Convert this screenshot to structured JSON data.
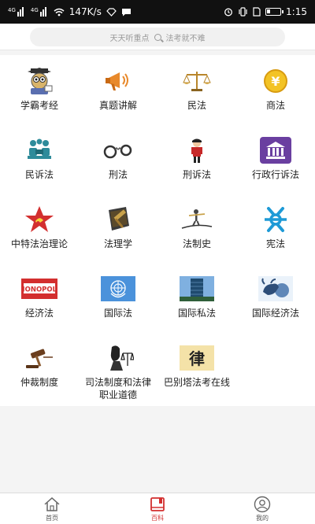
{
  "status": {
    "sim1": "4G",
    "sim2": "4G",
    "speed": "147K/s",
    "time": "1:15"
  },
  "search": {
    "left": "天天听重点",
    "right": "法考就不难"
  },
  "categories": [
    "学霸考经",
    "真题讲解",
    "民法",
    "商法",
    "民诉法",
    "刑法",
    "刑诉法",
    "行政行诉法",
    "中特法治理论",
    "法理学",
    "法制史",
    "宪法",
    "经济法",
    "国际法",
    "国际私法",
    "国际经济法",
    "仲裁制度",
    "司法制度和法律\n职业道德",
    "巴别塔法考在线"
  ],
  "tabs": [
    "首页",
    "百科",
    "我的"
  ],
  "colors": {
    "accent": "#d32f2f",
    "gold": "#c8971e"
  }
}
